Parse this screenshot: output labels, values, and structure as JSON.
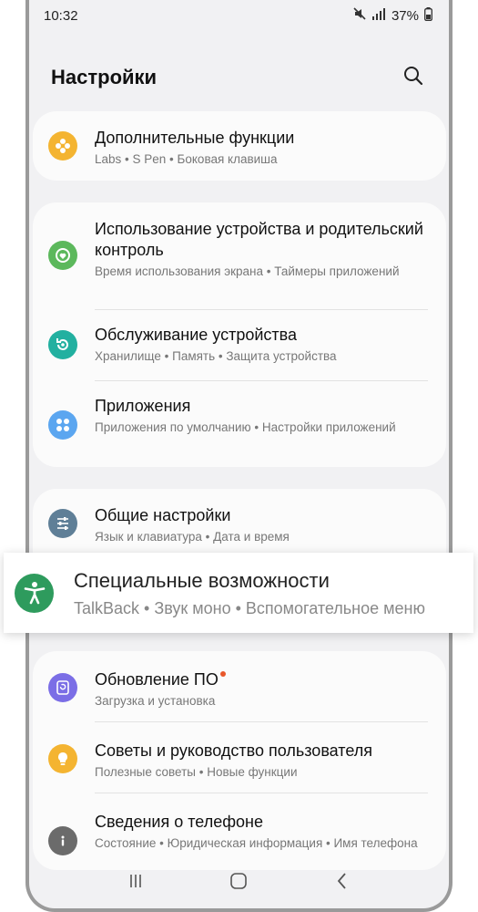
{
  "status": {
    "time": "10:32",
    "battery": "37%",
    "icons": [
      "mute-icon",
      "signal-icon",
      "battery-icon"
    ]
  },
  "header": {
    "title": "Настройки",
    "search_icon": "search-icon"
  },
  "groups": [
    {
      "items": [
        {
          "title": "Дополнительные функции",
          "subtitle": "Labs  •  S Pen  •  Боковая клавиша",
          "icon": "gear-flower-icon",
          "color": "#f4b431"
        }
      ]
    },
    {
      "items": [
        {
          "title": "Использование устройства и родительский контроль",
          "subtitle": "Время использования экрана  •  Таймеры приложений",
          "icon": "digital-wellbeing-icon",
          "color": "#5cb85c"
        },
        {
          "title": "Обслуживание устройства",
          "subtitle": "Хранилище  •  Память  •  Защита устройства",
          "icon": "device-care-icon",
          "color": "#22b0a0"
        },
        {
          "title": "Приложения",
          "subtitle": "Приложения по умолчанию  •  Настройки приложений",
          "icon": "apps-grid-icon",
          "color": "#5ba6f0"
        }
      ]
    },
    {
      "items": [
        {
          "title": "Общие настройки",
          "subtitle": "Язык и клавиатура  •  Дата и время",
          "icon": "sliders-icon",
          "color": "#5f7f97"
        }
      ]
    },
    {
      "items": [
        {
          "title": "Обновление ПО",
          "subtitle": "Загрузка и установка",
          "icon": "software-update-icon",
          "color": "#7b6ee6",
          "badge": true
        },
        {
          "title": "Советы и руководство пользователя",
          "subtitle": "Полезные советы  •  Новые функции",
          "icon": "lightbulb-icon",
          "color": "#f4b431"
        },
        {
          "title": "Сведения о телефоне",
          "subtitle": "Состояние  •  Юридическая информация  •  Имя телефона",
          "icon": "info-icon",
          "color": "#6b6b6b"
        }
      ]
    }
  ],
  "highlight": {
    "title": "Специальные возможности",
    "subtitle": "TalkBack  •  Звук моно  •  Вспомогательное меню",
    "icon": "accessibility-icon",
    "color": "#2e9b5d"
  },
  "navbar": {
    "icons": [
      "recent-apps-icon",
      "home-icon",
      "back-icon"
    ]
  }
}
